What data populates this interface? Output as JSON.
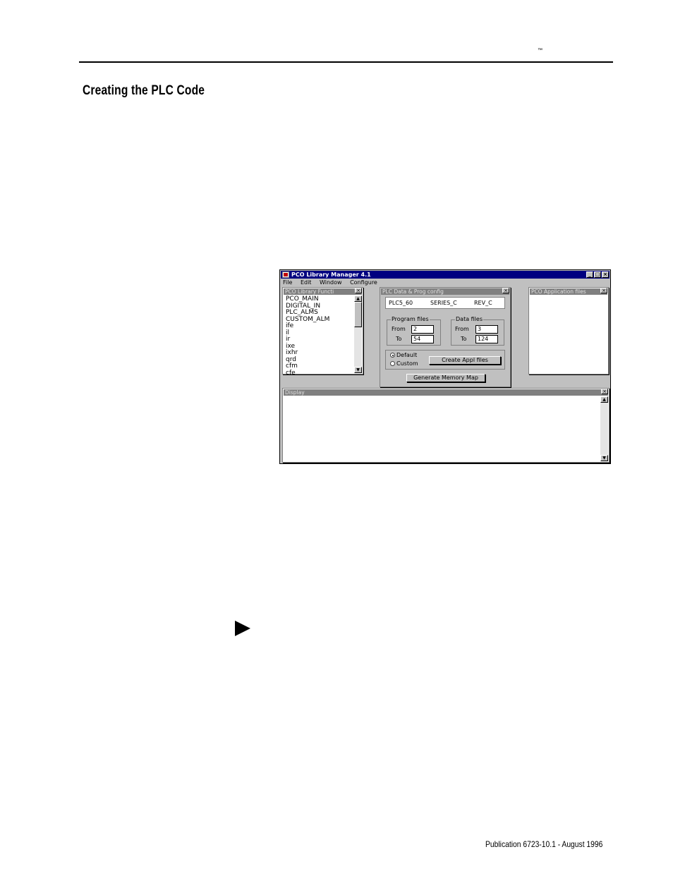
{
  "page": {
    "trademark": "™",
    "section_title": "Creating the PLC Code",
    "footer": "Publication 6723-10.1 - August 1996"
  },
  "app": {
    "title": "PCO Library Manager 4.1",
    "menu": [
      "File",
      "Edit",
      "Window",
      "Configure"
    ],
    "library_panel": {
      "title": "PCO Library Functi",
      "items": [
        "PCO_MAIN",
        "DIGITAL_IN",
        "PLC_ALMS",
        "CUSTOM_ALM",
        "ife",
        "il",
        "ir",
        "ixe",
        "ixhr",
        "qrd",
        "cfm",
        "cfe"
      ]
    },
    "config_panel": {
      "title": "PLC Data & Prog config",
      "plc_model": "PLC5_60",
      "series": "SERIES_C",
      "revision": "REV_C",
      "program_files": {
        "legend": "Program files",
        "from_label": "From",
        "from_value": "2",
        "to_label": "To",
        "to_value": "54"
      },
      "data_files": {
        "legend": "Data files",
        "from_label": "From",
        "from_value": "3",
        "to_label": "To",
        "to_value": "124"
      },
      "radio_default": "Default",
      "radio_custom": "Custom",
      "selected": "Default",
      "create_button": "Create Appl files",
      "generate_button": "Generate Memory Map"
    },
    "app_files_panel": {
      "title": "PCO Application files"
    },
    "display_panel": {
      "title": "Display"
    }
  }
}
